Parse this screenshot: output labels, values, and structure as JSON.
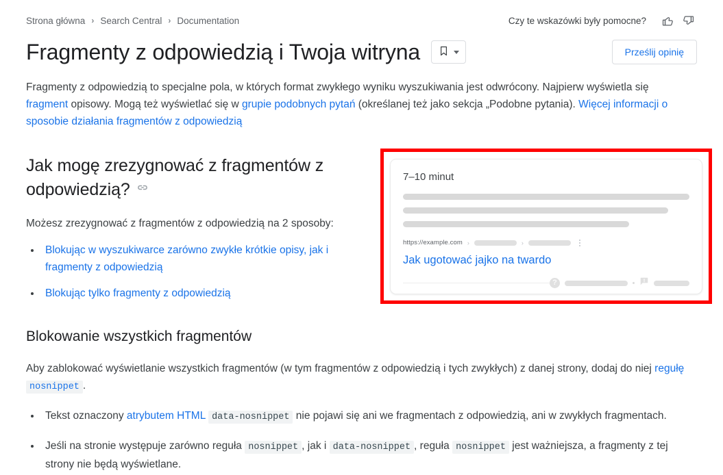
{
  "breadcrumb": {
    "items": [
      {
        "label": "Strona główna"
      },
      {
        "label": "Search Central"
      },
      {
        "label": "Documentation"
      }
    ],
    "separator": "›"
  },
  "header": {
    "feedback_question": "Czy te wskazówki były pomocne?",
    "thumbs_up_icon": "thumb-up-icon",
    "thumbs_down_icon": "thumb-down-icon",
    "title": "Fragmenty z odpowiedzią i Twoja witryna",
    "bookmark_icon": "bookmark-icon",
    "bookmark_caret_icon": "chevron-down-icon",
    "send_feedback_label": "Prześlij opinię"
  },
  "intro": {
    "part1": "Fragmenty z odpowiedzią to specjalne pola, w których format zwykłego wyniku wyszukiwania jest odwrócony. Najpierw wyświetla się ",
    "link1": "fragment",
    "part2": " opisowy. Mogą też wyświetlać się w ",
    "link2": "grupie podobnych pytań",
    "part3": " (określanej też jako sekcja „Podobne pytania). ",
    "link3": "Więcej informacji o sposobie działania fragmentów z odpowiedzią"
  },
  "section_optout": {
    "heading": "Jak mogę zrezygnować z fragmentów z odpowiedzią?",
    "anchor_icon": "link-anchor-icon",
    "paragraph": "Możesz zrezygnować z fragmentów z odpowiedzią na 2 sposoby:",
    "bullets": [
      "Blokując w wyszukiwarce zarówno zwykłe krótkie opisy, jak i fragmenty z odpowiedzią",
      "Blokując tylko fragmenty z odpowiedzią"
    ]
  },
  "serp_mock": {
    "answer_text": "7–10 minut",
    "url": "https://example.com",
    "breadcrumb_separator": "›",
    "result_title": "Jak ugotować jajko na twardo",
    "help_icon": "question-mark-icon",
    "feedback_icon": "feedback-flag-icon",
    "separator_dot": "·",
    "kebab_icon": "kebab-menu-icon",
    "highlight_color": "#ff0000"
  },
  "section_block_all": {
    "heading": "Blokowanie wszystkich fragmentów",
    "paragraph_part1": "Aby zablokować wyświetlanie wszystkich fragmentów (w tym fragmentów z odpowiedzią i tych zwykłych) z danej strony, dodaj do niej ",
    "paragraph_link": "regułę",
    "paragraph_code": "nosnippet",
    "paragraph_part2": ".",
    "bullet1_part1": "Tekst oznaczony ",
    "bullet1_link": "atrybutem HTML",
    "bullet1_code": "data-nosnippet",
    "bullet1_part2": " nie pojawi się ani we fragmentach z odpowiedzią, ani w zwykłych fragmentach.",
    "bullet2_part1": "Jeśli na stronie występuje zarówno reguła ",
    "bullet2_code1": "nosnippet",
    "bullet2_part2": ", jak i ",
    "bullet2_code2": "data-nosnippet",
    "bullet2_part3": ", reguła ",
    "bullet2_code3": "nosnippet",
    "bullet2_part4": " jest ważniejsza, a fragmenty z tej strony nie będą wyświetlane."
  },
  "colors": {
    "link": "#1a73e8",
    "text": "#3c4043",
    "title": "#202124",
    "muted": "#5f6368",
    "highlight": "#ff0000"
  }
}
